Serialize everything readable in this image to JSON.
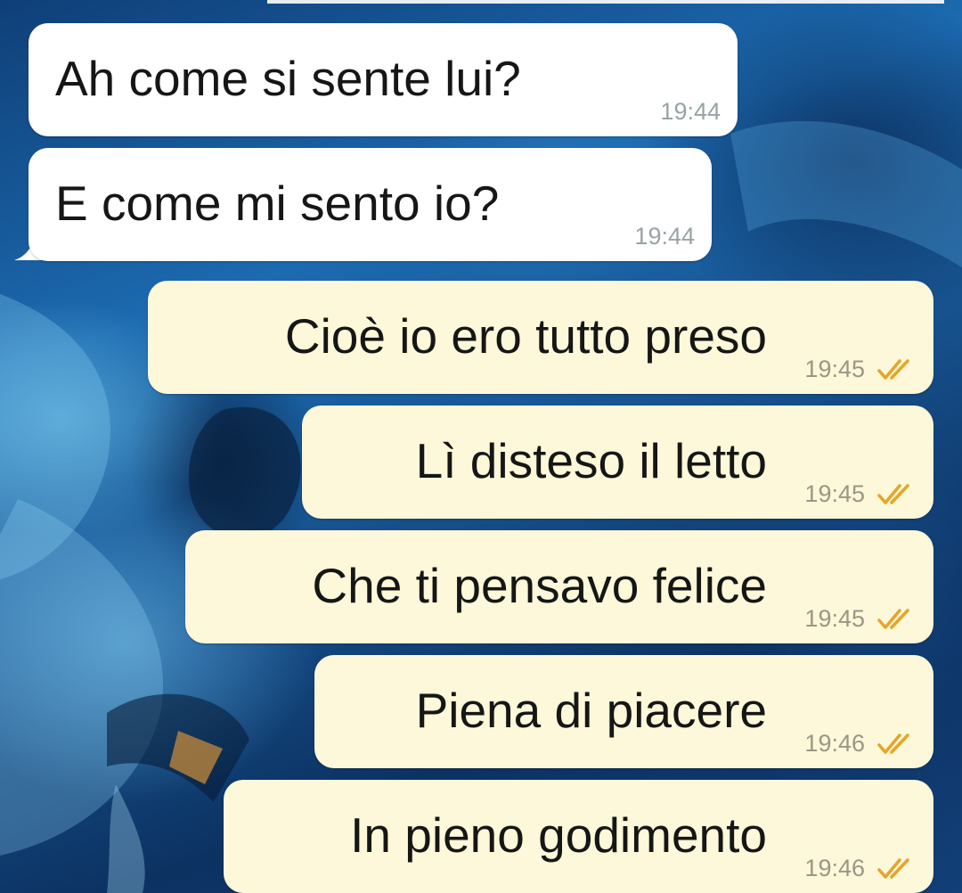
{
  "colors": {
    "incoming_bubble": "#ffffff",
    "outgoing_bubble": "#fdf8d9",
    "message_text": "#161616",
    "timestamp": "#9aa3a6",
    "read_ticks": "#e5a52c"
  },
  "messages": [
    {
      "direction": "incoming",
      "text": "Ah come si sente lui?",
      "time": "19:44"
    },
    {
      "direction": "incoming",
      "text": "E come mi sento io?",
      "time": "19:44"
    },
    {
      "direction": "outgoing",
      "text": "Cioè io ero tutto preso",
      "time": "19:45",
      "status_icon": "double-check-icon"
    },
    {
      "direction": "outgoing",
      "text": "Lì disteso il letto",
      "time": "19:45",
      "status_icon": "double-check-icon"
    },
    {
      "direction": "outgoing",
      "text": "Che ti pensavo felice",
      "time": "19:45",
      "status_icon": "double-check-icon"
    },
    {
      "direction": "outgoing",
      "text": "Piena di piacere",
      "time": "19:46",
      "status_icon": "double-check-icon"
    },
    {
      "direction": "outgoing",
      "text": "In pieno godimento",
      "time": "19:46",
      "status_icon": "double-check-icon"
    }
  ]
}
